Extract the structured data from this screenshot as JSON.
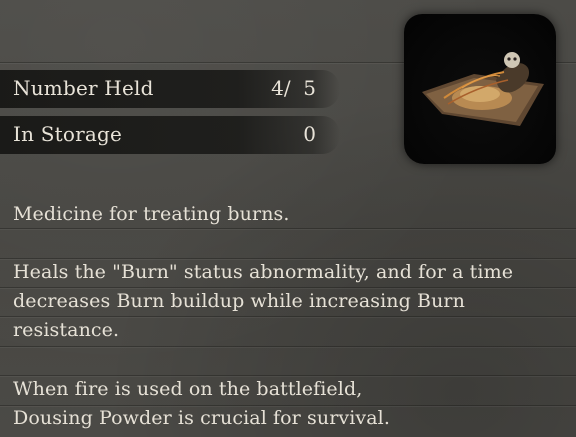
{
  "item": {
    "number_held_label": "Number Held",
    "number_held_value": "4/  5",
    "in_storage_label": "In Storage",
    "in_storage_value": "0",
    "icon": "dousing-powder-pouch-icon",
    "description": [
      "Medicine for treating burns.",
      "Heals the \"Burn\" status abnormality, and for a time",
      "decreases Burn buildup while increasing Burn",
      "resistance.",
      "When fire is used on the battlefield,",
      "Dousing Powder is crucial for survival."
    ]
  },
  "colors": {
    "background": "#4a4945",
    "text": "#e6e1d6",
    "bar": "#1a1a18"
  }
}
